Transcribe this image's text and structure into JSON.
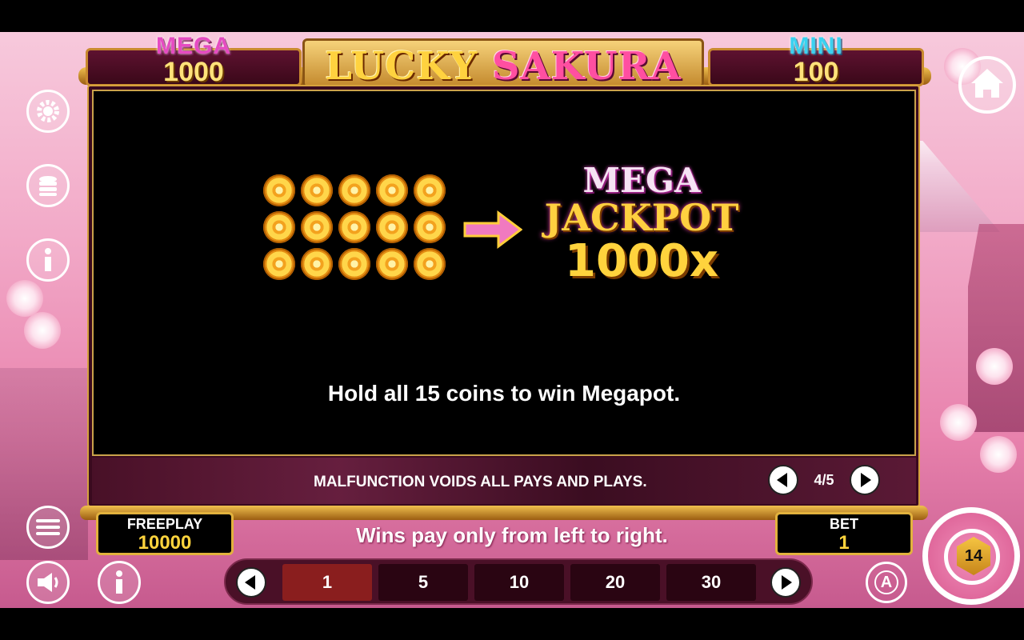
{
  "title": {
    "part1": "LUCKY",
    "part2": "SAKURA"
  },
  "jackpots": {
    "mega": {
      "label": "MEGA",
      "value": "1000"
    },
    "mini": {
      "label": "MINI",
      "value": "100"
    }
  },
  "info": {
    "jackpot_line1": "MEGA",
    "jackpot_line2": "JACKPOT",
    "multiplier": "1000x",
    "description": "Hold all 15 coins to win Megapot.",
    "coin_count": 15
  },
  "disclaimer": "MALFUNCTION VOIDS ALL PAYS AND PLAYS.",
  "pager": {
    "page": "4/5"
  },
  "freeplay": {
    "label": "FREEPLAY",
    "value": "10000"
  },
  "bet": {
    "label": "BET",
    "value": "1"
  },
  "wins_text": "Wins pay only from left to right.",
  "bet_options": [
    "1",
    "5",
    "10",
    "20",
    "30"
  ],
  "selected_bet": "1",
  "spin_badge": "14",
  "auto_label": "A",
  "colors": {
    "accent_gold": "#ffd33d",
    "mega_pink": "#e64bc2",
    "mini_cyan": "#3ad2f0",
    "selected_bet": "#8a1e1e"
  },
  "icons": [
    "settings-gear-icon",
    "coins-stack-icon",
    "info-icon",
    "menu-icon",
    "sound-icon",
    "home-icon",
    "spin-icon",
    "autoplay-icon"
  ]
}
